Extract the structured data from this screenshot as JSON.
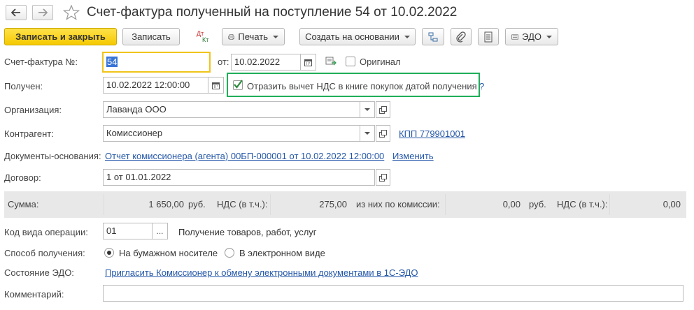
{
  "window": {
    "title": "Счет-фактура полученный на поступление 54 от 10.02.2022"
  },
  "toolbar": {
    "save_close": "Записать и закрыть",
    "save": "Записать",
    "dt_kt_top": "Дт",
    "dt_kt_bottom": "Кт",
    "print": "Печать",
    "create_based": "Создать на основании",
    "edo": "ЭДО"
  },
  "form": {
    "invoice_no_label": "Счет-фактура №:",
    "invoice_no_value": "54",
    "date_from_label": "от:",
    "date_value": "10.02.2022",
    "original_label": "Оригинал",
    "received_label": "Получен:",
    "received_value": "10.02.2022 12:00:00",
    "vat_checkbox_label": "Отразить вычет НДС в книге покупок датой получения",
    "help": "?",
    "org_label": "Организация:",
    "org_value": "Лаванда ООО",
    "contractor_label": "Контрагент:",
    "contractor_value": "Комиссионер",
    "kpp_link": "КПП 779901001",
    "base_docs_label": "Документы-основания:",
    "base_doc_link": "Отчет комиссионера (агента) 00БП-000001 от 10.02.2022 12:00:00",
    "change_link": "Изменить",
    "contract_label": "Договор:",
    "contract_value": "1 от 01.01.2022"
  },
  "summary": {
    "sum_label": "Сумма:",
    "sum_value": "1 650,00",
    "currency1": "руб.",
    "vat_label1": "НДС (в т.ч.):",
    "vat_value1": "275,00",
    "commission_label": "из них по комиссии:",
    "commission_value": "0,00",
    "currency2": "руб.",
    "vat_label2": "НДС (в т.ч.):",
    "vat_value2": "0,00"
  },
  "bottom": {
    "op_code_label": "Код вида операции:",
    "op_code_value": "01",
    "op_code_desc": "Получение товаров, работ, услуг",
    "method_label": "Способ получения:",
    "method_paper": "На бумажном носителе",
    "method_electronic": "В электронном виде",
    "edo_state_label": "Состояние ЭДО:",
    "edo_invite_link": "Пригласить Комиссионер к обмену электронными документами в 1С-ЭДО",
    "comment_label": "Комментарий:",
    "comment_value": ""
  },
  "colors": {
    "accent_yellow": "#f5c900",
    "highlight_green": "#1fae5a",
    "link": "#2457a8"
  }
}
